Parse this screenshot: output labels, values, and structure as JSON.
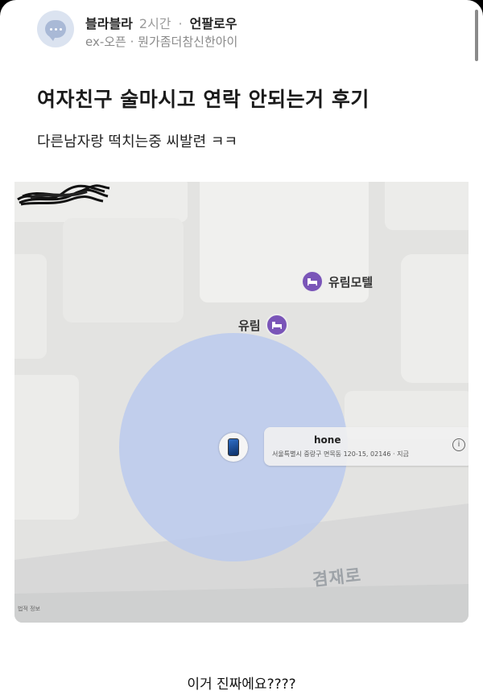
{
  "header": {
    "author": "블라블라",
    "time": "2시간",
    "separator": "·",
    "follow_label": "언팔로우",
    "channel": "ex-오픈 · 뭔가좀더참신한아이"
  },
  "post": {
    "title": "여자친구 술마시고 연락 안되는거 후기",
    "body": "다른남자랑 떡치는중 씨발련 ㅋㅋ"
  },
  "map": {
    "poi_motel": "유림모텔",
    "poi_yurim": "유림",
    "device_name": "hone",
    "device_address": "서울특별시 중랑구 면목동 120-15, 02146 · 지금",
    "info_symbol": "i",
    "road_name": "겸재로",
    "legal": "법적 정보",
    "accent_color": "#7a55b8",
    "accuracy_circle_color": "#b9c9ee"
  },
  "comment": "이거 진짜에요????"
}
